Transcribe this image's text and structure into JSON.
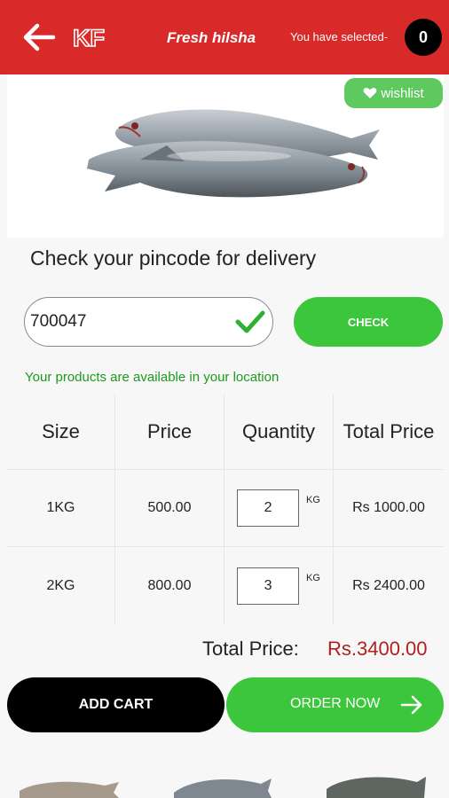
{
  "header": {
    "back_icon": "back-arrow-icon",
    "logo_text": "KF",
    "title": "Fresh hilsha",
    "selected_label": "You have selected-",
    "selected_count": "0",
    "color": "#d92a2a"
  },
  "product": {
    "image": "hilsa-fish-image",
    "wishlist_label": "wishlist"
  },
  "pincode": {
    "title": "Check your pincode for delivery",
    "value": "700047",
    "check_label": "CHECK",
    "message": "Your products are available in your location"
  },
  "table": {
    "headers": [
      "Size",
      "Price",
      "Quantity",
      "Total Price"
    ],
    "rows": [
      {
        "size": "1KG",
        "price": "500.00",
        "qty": "2",
        "unit": "KG",
        "total": "Rs 1000.00"
      },
      {
        "size": "2KG",
        "price": "800.00",
        "qty": "3",
        "unit": "KG",
        "total": "Rs 2400.00"
      }
    ]
  },
  "summary": {
    "total_label": "Total Price:",
    "total_value": "Rs.3400.00"
  },
  "actions": {
    "add_cart": "ADD CART",
    "order_now": "ORDER NOW"
  },
  "colors": {
    "green": "#3bc63b",
    "red": "#d92a2a",
    "price_red": "#b02020"
  }
}
